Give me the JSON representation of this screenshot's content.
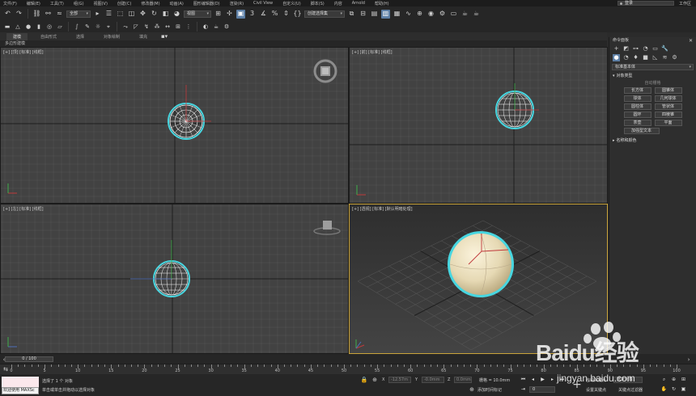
{
  "menubar": {
    "items": [
      "文件(F)",
      "编辑(E)",
      "工具(T)",
      "组(G)",
      "视图(V)",
      "创建(C)",
      "修改器(M)",
      "动画(A)",
      "图形编辑器(D)",
      "渲染(R)",
      "Civil View",
      "自定义(U)",
      "脚本(S)",
      "内容",
      "Arnold",
      "帮助(H)"
    ],
    "login": "登录",
    "workspace_label": "工作区"
  },
  "toolbar1": {
    "filter_select": "全部",
    "view_select": "视图",
    "selection_set": "创建选择集"
  },
  "ribbon": {
    "tabs": [
      "建模",
      "自由形式",
      "选择",
      "对象绘制",
      "填充"
    ],
    "sub_label": "多边形建模"
  },
  "viewports": {
    "top": "[+] [顶] [标准] [线框]",
    "front": "[+] [前] [标准] [线框]",
    "left": "[+] [左] [标准] [线框]",
    "perspective": "[+] [透视] [标准] [默认明暗处理]"
  },
  "command_panel": {
    "title": "命令面板",
    "category": "标准基本体",
    "object_type_header": "对象类型",
    "autogrid": "自动栅格",
    "buttons": [
      "长方体",
      "圆锥体",
      "球体",
      "几何球体",
      "圆柱体",
      "管状体",
      "圆环",
      "四棱锥",
      "茶壶",
      "平面",
      "加强型文本"
    ],
    "name_color_header": "名称和颜色"
  },
  "timeline": {
    "slider": "0 / 100",
    "ticks": [
      0,
      5,
      10,
      15,
      20,
      25,
      30,
      35,
      40,
      45,
      50,
      55,
      60,
      65,
      70,
      75,
      80,
      85,
      90,
      95,
      100
    ]
  },
  "status": {
    "maxscript": "欢迎使用 MAXSc",
    "selected": "选择了 1 个 对象",
    "prompt": "单击或单击并拖动以选择对象",
    "x_label": "X",
    "y_label": "Y",
    "z_label": "Z",
    "x_value": "-12.57m",
    "y_value": "-0.0mm",
    "z_value": "0.0mm",
    "grid": "栅格 = 10.0mm",
    "add_time_tag": "添加时间标记",
    "auto_key": "自动关键点",
    "selected_obj": "选定对象",
    "set_key": "设置关键点",
    "key_filters": "关键点过滤器",
    "frame": "0"
  },
  "watermark": {
    "main": "Baidu经验",
    "sub": "jingyan.baidu.com"
  },
  "colors": {
    "sphere_highlight": "#47d6e0",
    "sphere_fill": "#efe5c6",
    "grid_line": "#555555",
    "active_border": "#c9a33a"
  }
}
